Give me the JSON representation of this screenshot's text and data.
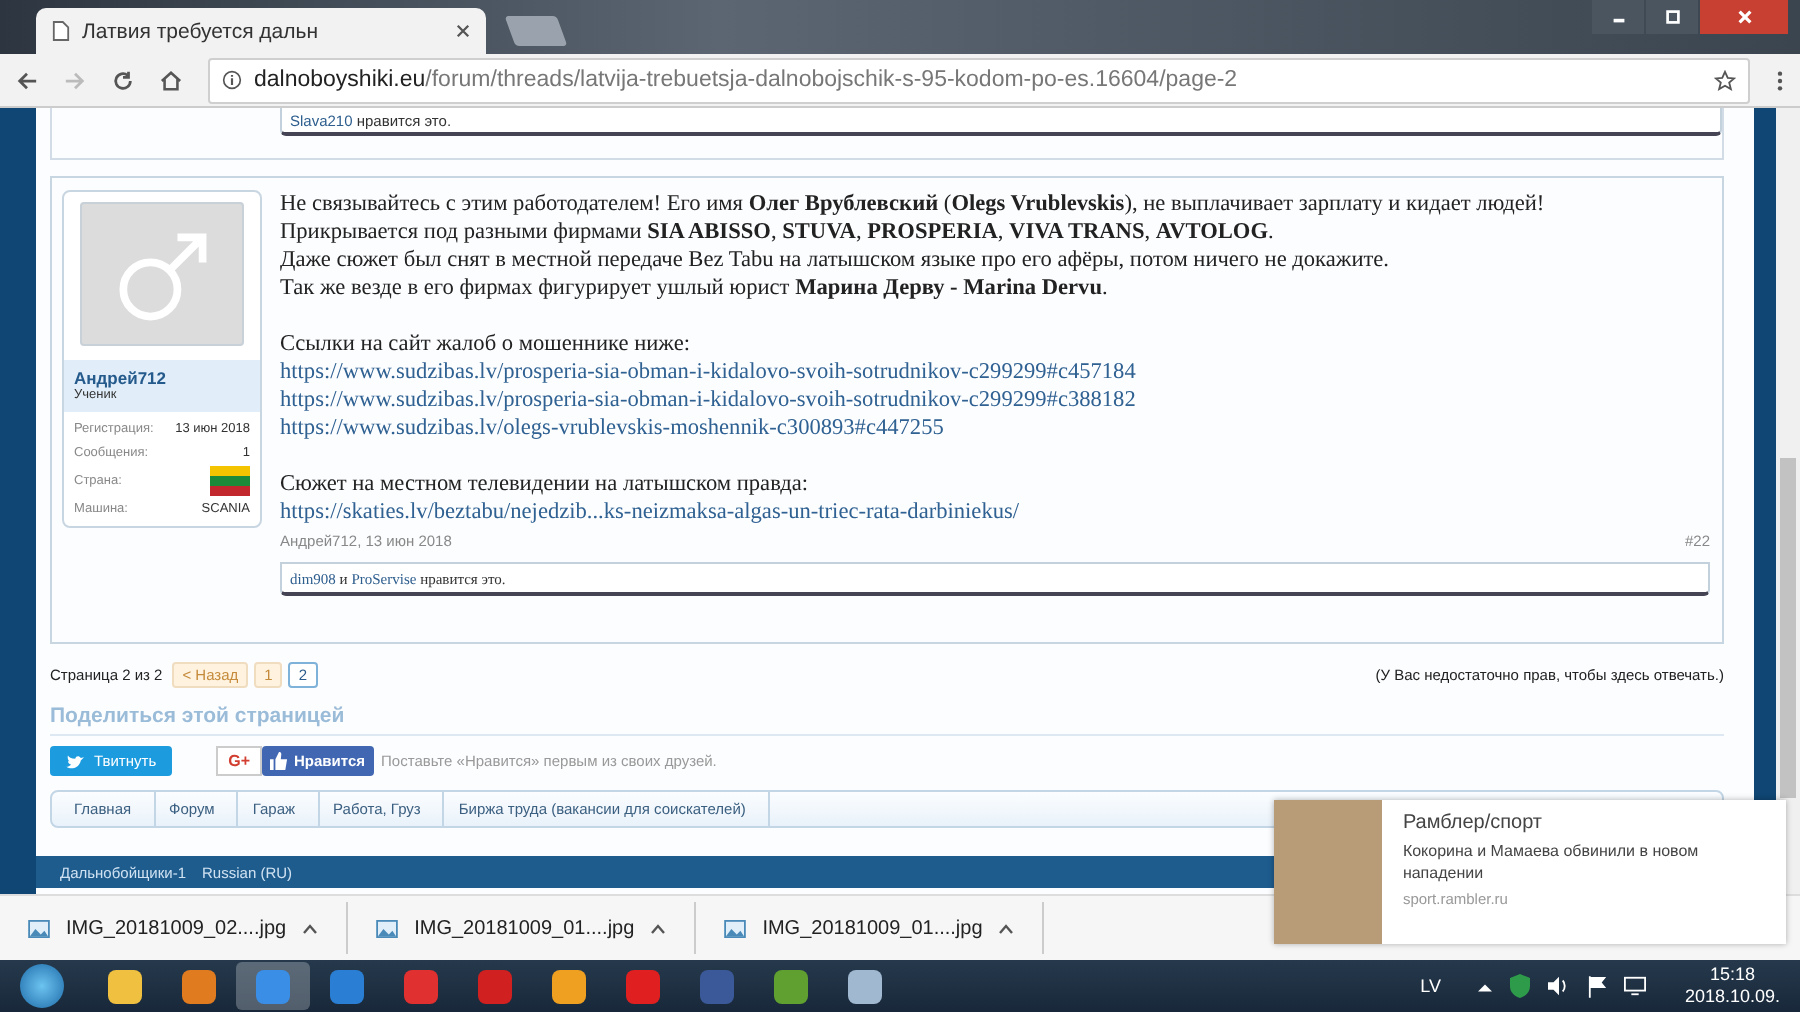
{
  "browser": {
    "tab_title": "Латвия требуется дальн",
    "url_domain": "dalnoboyshiki.eu",
    "url_path": "/forum/threads/latvija-trebuetsja-dalnobojschik-s-95-kodom-po-es.16604/page-2"
  },
  "previous_post": {
    "likes": [
      "Slava210"
    ],
    "likes_text": "нравится это."
  },
  "post": {
    "author": {
      "name": "Андрей712",
      "title": "Ученик",
      "stats": [
        {
          "label": "Регистрация:",
          "value": "13 июн 2018",
          "kind": "text"
        },
        {
          "label": "Сообщения:",
          "value": "1",
          "kind": "text"
        },
        {
          "label": "Страна:",
          "kind": "flag"
        },
        {
          "label": "Машина:",
          "value": "SCANIA",
          "kind": "text"
        }
      ]
    },
    "paragraphs": [
      [
        {
          "kind": "text",
          "text": "Не связывайтесь с этим работодателем! Его имя **Олег Врублевский** (**Olegs Vrublevskis**), не выплачивает зарплату и кидает людей!"
        },
        {
          "kind": "text",
          "text": "Прикрывается под разными фирмами **SIA ABISSO**, **STUVA**, **PROSPERIA**, **VIVA TRANS**, **AVTOLOG**."
        },
        {
          "kind": "text",
          "text": "Даже сюжет был снят в местной передаче Bez Tabu на латышском языке про его афёры, потом ничего не докажите."
        },
        {
          "kind": "text",
          "text": "Так же везде в его фирмах фигурирует ушлый юрист **Марина Дерву - Marina Dervu**."
        }
      ],
      [
        {
          "kind": "text",
          "text": "Ссылки на сайт жалоб о мошеннике ниже:"
        },
        {
          "kind": "link",
          "text": "https://www.sudzibas.lv/prosperia-sia-obman-i-kidalovo-svoih-sotrudnikov-c299299#c457184"
        },
        {
          "kind": "link",
          "text": "https://www.sudzibas.lv/prosperia-sia-obman-i-kidalovo-svoih-sotrudnikov-c299299#c388182"
        },
        {
          "kind": "link",
          "text": "https://www.sudzibas.lv/olegs-vrublevskis-moshennik-c300893#c447255"
        }
      ],
      [
        {
          "kind": "text",
          "text": "Сюжет на местном телевидении на латышском правда:"
        },
        {
          "kind": "link",
          "text": "https://skaties.lv/beztabu/nejedzib...ks-neizmaksa-algas-un-triec-rata-darbiniekus/"
        }
      ]
    ],
    "meta": "Андрей712, 13 июн 2018",
    "number": "#22",
    "likes": {
      "users": [
        "dim908",
        "ProServise"
      ],
      "joiner": "и",
      "text": "нравится это."
    }
  },
  "pagination": {
    "label": "Страница 2 из 2",
    "prev": "< Назад",
    "pages": [
      {
        "label": "1",
        "selected": false
      },
      {
        "label": "2",
        "selected": true
      }
    ]
  },
  "reply_note": "(У Вас недостаточно прав, чтобы здесь отвечать.)",
  "share": {
    "heading": "Поделиться этой страницей",
    "tweet": "Твитнуть",
    "gplus": "G+",
    "like": "Нравится",
    "like_note": "Поставьте «Нравится» первым из своих друзей."
  },
  "breadcrumbs": [
    "Главная",
    "Форум",
    "Гараж",
    "Работа, Груз",
    "Биржа труда (вакансии для соискателей)"
  ],
  "footer": [
    "Дальнобойщики-1",
    "Russian (RU)"
  ],
  "notification": {
    "source": "Рамблер/спорт",
    "headline": "Кокорина и Мамаева обвинили в новом нападении",
    "domain": "sport.rambler.ru"
  },
  "downloads": [
    "IMG_20181009_02....jpg",
    "IMG_20181009_01....jpg",
    "IMG_20181009_01....jpg"
  ],
  "taskbar": {
    "language": "LV",
    "time": "15:18",
    "date": "2018.10.09."
  }
}
